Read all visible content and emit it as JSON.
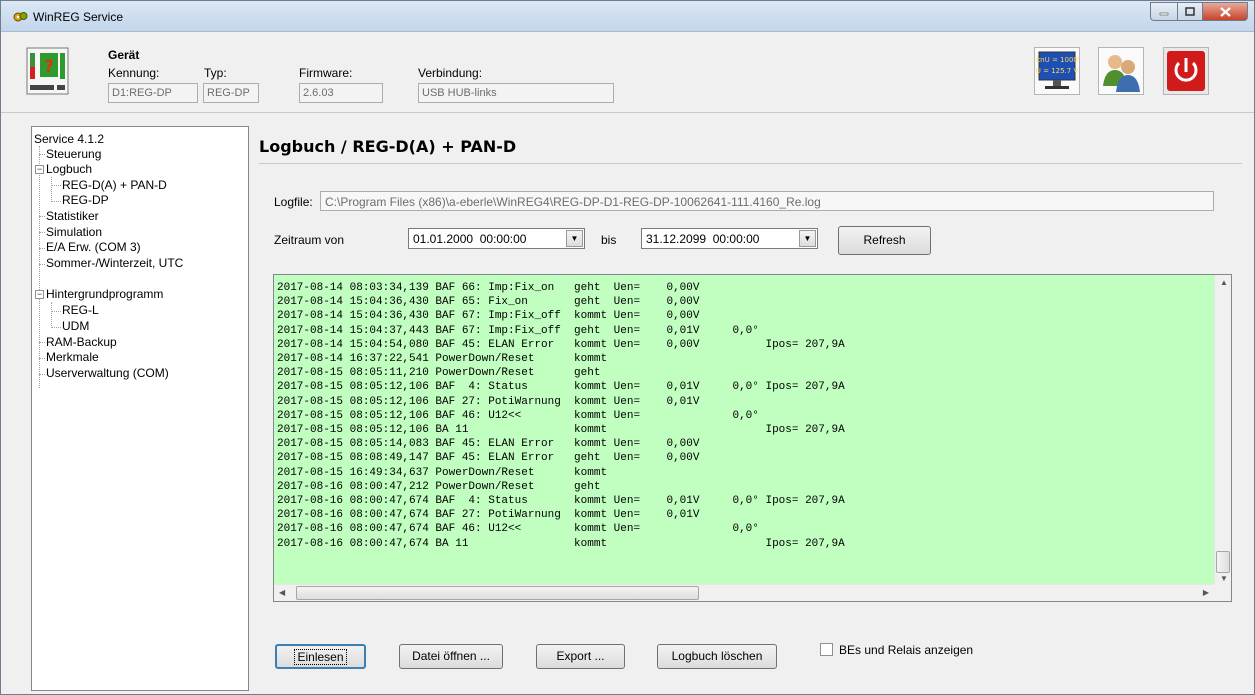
{
  "window": {
    "title": "WinREG Service"
  },
  "header": {
    "device_label": "Gerät",
    "kennung_label": "Kennung:",
    "kennung_value": "D1:REG-DP",
    "typ_label": "Typ:",
    "typ_value": "REG-DP",
    "firmware_label": "Firmware:",
    "firmware_value": "2.6.03",
    "verbindung_label": "Verbindung:",
    "verbindung_value": "USB HUB-links",
    "monitor_line1": "knU = 1000",
    "monitor_line2": "U = 125.7 V"
  },
  "tree": {
    "root": "Service 4.1.2",
    "items": [
      "Steuerung",
      "Logbuch",
      "REG-D(A) + PAN-D",
      "REG-DP",
      "Statistiker",
      "Simulation",
      "E/A Erw. (COM 3)",
      "Sommer-/Winterzeit, UTC",
      "Hintergrundprogramm",
      "REG-L",
      "UDM",
      "RAM-Backup",
      "Merkmale",
      "Userverwaltung (COM)"
    ]
  },
  "main": {
    "title": "Logbuch / REG-D(A) + PAN-D",
    "logfile_label": "Logfile:",
    "logfile_value": "C:\\Program Files (x86)\\a-eberle\\WinREG4\\REG-DP-D1-REG-DP-10062641-111.4160_Re.log",
    "zeitraum_label": "Zeitraum von",
    "from_value": "01.01.2000  00:00:00",
    "bis_label": "bis",
    "to_value": "31.12.2099  00:00:00",
    "refresh_label": "Refresh",
    "log_lines": [
      "2017-08-14 08:03:34,139 BAF 66: Imp:Fix_on   geht  Uen=    0,00V",
      "2017-08-14 15:04:36,430 BAF 65: Fix_on       geht  Uen=    0,00V",
      "2017-08-14 15:04:36,430 BAF 67: Imp:Fix_off  kommt Uen=    0,00V",
      "2017-08-14 15:04:37,443 BAF 67: Imp:Fix_off  geht  Uen=    0,01V     0,0°",
      "2017-08-14 15:04:54,080 BAF 45: ELAN Error   kommt Uen=    0,00V          Ipos= 207,9A",
      "2017-08-14 16:37:22,541 PowerDown/Reset      kommt",
      "2017-08-15 08:05:11,210 PowerDown/Reset      geht",
      "2017-08-15 08:05:12,106 BAF  4: Status       kommt Uen=    0,01V     0,0° Ipos= 207,9A",
      "2017-08-15 08:05:12,106 BAF 27: PotiWarnung  kommt Uen=    0,01V",
      "2017-08-15 08:05:12,106 BAF 46: U12<<        kommt Uen=              0,0°",
      "2017-08-15 08:05:12,106 BA 11                kommt                        Ipos= 207,9A",
      "2017-08-15 08:05:14,083 BAF 45: ELAN Error   kommt Uen=    0,00V",
      "2017-08-15 08:08:49,147 BAF 45: ELAN Error   geht  Uen=    0,00V",
      "2017-08-15 16:49:34,637 PowerDown/Reset      kommt",
      "2017-08-16 08:00:47,212 PowerDown/Reset      geht",
      "2017-08-16 08:00:47,674 BAF  4: Status       kommt Uen=    0,01V     0,0° Ipos= 207,9A",
      "2017-08-16 08:00:47,674 BAF 27: PotiWarnung  kommt Uen=    0,01V",
      "2017-08-16 08:00:47,674 BAF 46: U12<<        kommt Uen=              0,0°",
      "2017-08-16 08:00:47,674 BA 11                kommt                        Ipos= 207,9A"
    ],
    "buttons": {
      "einlesen": "Einlesen",
      "datei_oeffnen": "Datei öffnen ...",
      "export": "Export ...",
      "logbuch_loeschen": "Logbuch löschen"
    },
    "checkbox_label": "BEs und Relais anzeigen"
  }
}
